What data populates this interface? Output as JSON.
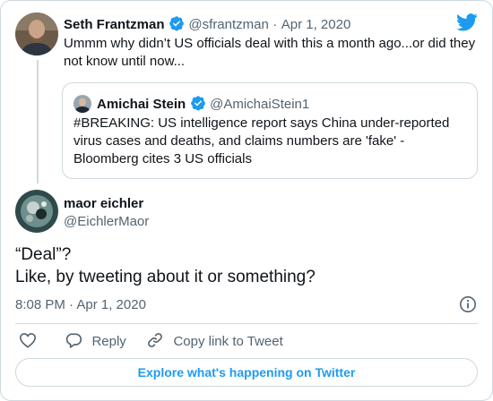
{
  "brand_color": "#1d9bf0",
  "main_tweet": {
    "author_name": "Seth Frantzman",
    "handle": "@sfrantzman",
    "date": "Apr 1, 2020",
    "text": "Ummm why didn’t US officials deal with this a month ago...or did they not know until now...",
    "verified": true
  },
  "quoted_tweet": {
    "author_name": "Amichai Stein",
    "handle": "@AmichaiStein1",
    "verified": true,
    "text": "#BREAKING: US intelligence report says China under-reported virus cases and deaths, and claims numbers are 'fake' - Bloomberg cites 3 US officials"
  },
  "reply_tweet": {
    "author_name": "maor eichler",
    "handle": "@EichlerMaor",
    "text_line1": "“Deal”?",
    "text_line2": "Like, by tweeting about it or something?",
    "timestamp": "8:08 PM · Apr 1, 2020"
  },
  "actions": {
    "reply_label": "Reply",
    "copy_link_label": "Copy link to Tweet"
  },
  "explore_button_label": "Explore what's happening on Twitter",
  "icons": {
    "logo": "twitter-bird-icon",
    "verified": "verified-badge-icon",
    "info": "info-icon",
    "like": "heart-icon",
    "reply": "reply-bubble-icon",
    "copy_link": "link-icon"
  }
}
